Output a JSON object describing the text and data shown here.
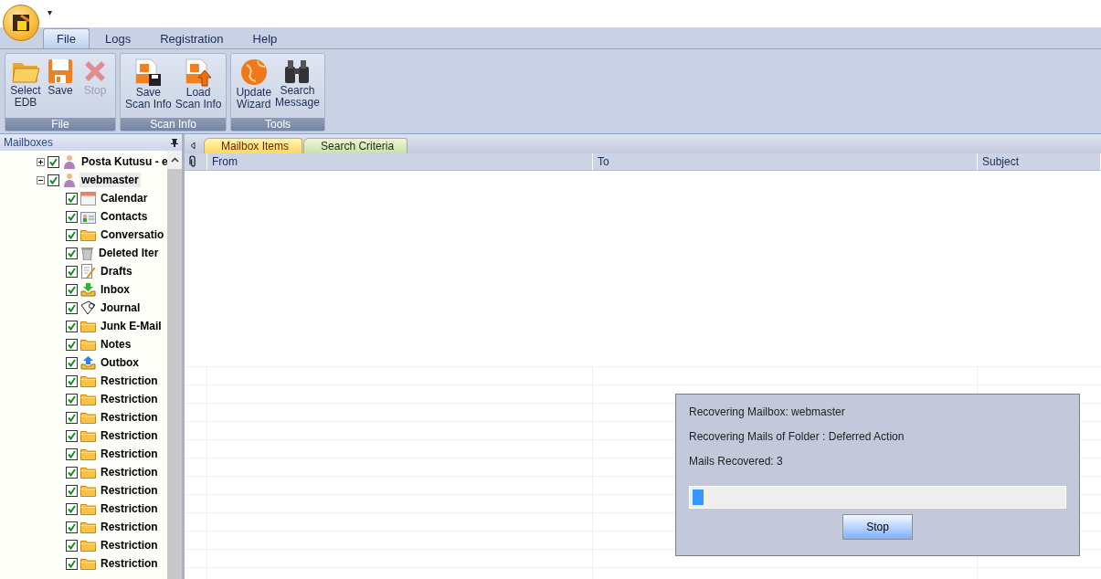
{
  "quick_access": {
    "label": "▾"
  },
  "menu_tabs": [
    {
      "label": "File",
      "selected": true
    },
    {
      "label": "Logs",
      "selected": false
    },
    {
      "label": "Registration",
      "selected": false
    },
    {
      "label": "Help",
      "selected": false
    }
  ],
  "ribbon_groups": [
    {
      "title": "File",
      "buttons": [
        {
          "kind": "open",
          "label": "Select\nEDB",
          "disabled": false
        },
        {
          "kind": "save",
          "label": "Save",
          "disabled": false
        },
        {
          "kind": "stop",
          "label": "Stop",
          "disabled": true
        }
      ]
    },
    {
      "title": "Scan Info",
      "buttons": [
        {
          "kind": "savescan",
          "label": "Save\nScan Info",
          "disabled": false
        },
        {
          "kind": "loadscan",
          "label": "Load\nScan Info",
          "disabled": false
        }
      ]
    },
    {
      "title": "Tools",
      "buttons": [
        {
          "kind": "globe",
          "label": "Update\nWizard",
          "disabled": false
        },
        {
          "kind": "binoculars",
          "label": "Search\nMessage",
          "disabled": false
        }
      ]
    }
  ],
  "mailboxes": {
    "title": "Mailboxes",
    "tree": [
      {
        "label": "Posta Kutusu - e",
        "kind": "user",
        "checked": true,
        "expanded": false,
        "selected": false
      },
      {
        "label": "webmaster",
        "kind": "user",
        "checked": true,
        "expanded": true,
        "selected": true,
        "children": [
          {
            "label": "Calendar",
            "kind": "calendar",
            "checked": true
          },
          {
            "label": "Contacts",
            "kind": "contacts",
            "checked": true
          },
          {
            "label": "Conversatio",
            "kind": "folder",
            "checked": true
          },
          {
            "label": "Deleted Iter",
            "kind": "trash",
            "checked": true
          },
          {
            "label": "Drafts",
            "kind": "drafts",
            "checked": true
          },
          {
            "label": "Inbox",
            "kind": "inbox",
            "checked": true
          },
          {
            "label": "Journal",
            "kind": "journal",
            "checked": true
          },
          {
            "label": "Junk E-Mail",
            "kind": "folder",
            "checked": true
          },
          {
            "label": "Notes",
            "kind": "folder",
            "checked": true
          },
          {
            "label": "Outbox",
            "kind": "outbox",
            "checked": true
          },
          {
            "label": "Restriction",
            "kind": "folder",
            "checked": true
          },
          {
            "label": "Restriction",
            "kind": "folder",
            "checked": true
          },
          {
            "label": "Restriction",
            "kind": "folder",
            "checked": true
          },
          {
            "label": "Restriction",
            "kind": "folder",
            "checked": true
          },
          {
            "label": "Restriction",
            "kind": "folder",
            "checked": true
          },
          {
            "label": "Restriction",
            "kind": "folder",
            "checked": true
          },
          {
            "label": "Restriction",
            "kind": "folder",
            "checked": true
          },
          {
            "label": "Restriction",
            "kind": "folder",
            "checked": true
          },
          {
            "label": "Restriction",
            "kind": "folder",
            "checked": true
          },
          {
            "label": "Restriction",
            "kind": "folder",
            "checked": true
          },
          {
            "label": "Restriction",
            "kind": "folder",
            "checked": true
          }
        ]
      }
    ]
  },
  "content_tabs": [
    {
      "label": "Mailbox Items",
      "selected": true
    },
    {
      "label": "Search Criteria",
      "selected": false
    }
  ],
  "table": {
    "columns": [
      "From",
      "To",
      "Subject"
    ]
  },
  "progress_dialog": {
    "lines": [
      "Recovering Mailbox: webmaster",
      "Recovering Mails of Folder : Deferred Action",
      "Mails Recovered: 3"
    ],
    "level": 0.02,
    "button": "Stop"
  }
}
